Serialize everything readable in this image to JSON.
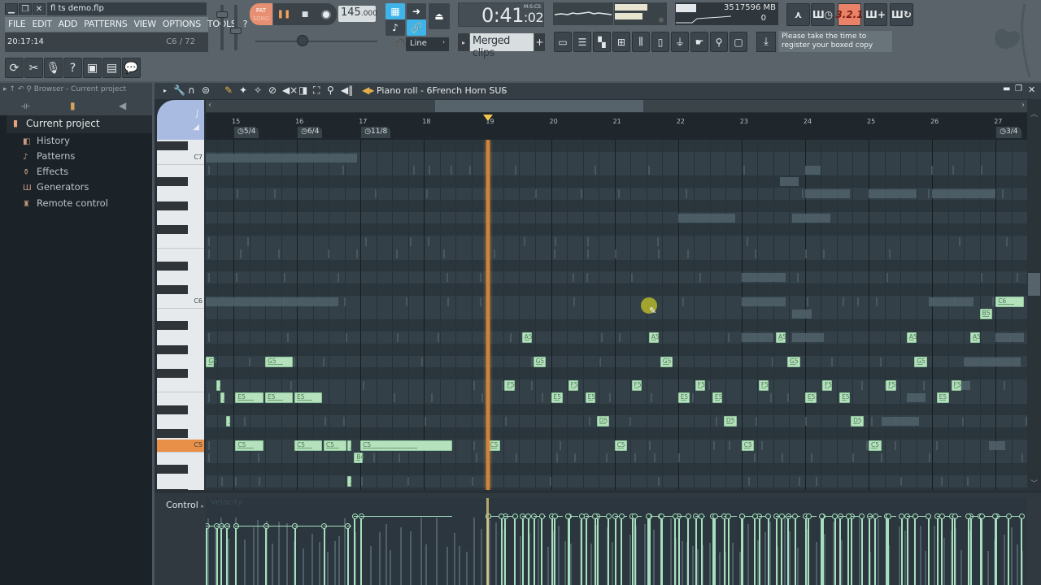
{
  "window": {
    "title": "fl ts demo.flp",
    "controls": [
      "minimize",
      "restore",
      "close"
    ]
  },
  "menu": [
    "FILE",
    "EDIT",
    "ADD",
    "PATTERNS",
    "VIEW",
    "OPTIONS",
    "TOOLS",
    "?"
  ],
  "hint_bar": {
    "time": "20:17:14",
    "note": "C6 / 72"
  },
  "toolbar_left": [
    "refresh-icon",
    "cut-audio-icon",
    "microphone-icon",
    "help-icon",
    "save-icon",
    "export-audio-icon",
    "chat-icon"
  ],
  "transport": {
    "pat_label": "PAT",
    "song_label": "SONG",
    "tempo_int": "145",
    "tempo_frac": ".000",
    "time": "0:41",
    "time_sub": ":02",
    "time_format": "M:S:CS"
  },
  "snap": {
    "value": "Line"
  },
  "pattern": {
    "name": "Merged clips",
    "add_label": "+"
  },
  "cpu": {
    "cpu_value": "35",
    "memory": "17596 MB",
    "polyphony": "0"
  },
  "register_notice": "Please take the time to register your boxed copy",
  "right_buttons": [
    "metronome",
    "wait-record",
    "3.2.1",
    "step-edit",
    "loop-record"
  ],
  "right_button_countdown": "3.2.1",
  "browser": {
    "header": "Browser - Current project",
    "root": "Current project",
    "items": [
      {
        "label": "History",
        "icon": "history-icon"
      },
      {
        "label": "Patterns",
        "icon": "note-icon"
      },
      {
        "label": "Effects",
        "icon": "effects-icon"
      },
      {
        "label": "Generators",
        "icon": "generators-icon"
      },
      {
        "label": "Remote control",
        "icon": "remote-icon"
      }
    ]
  },
  "piano_roll": {
    "title": "Piano roll - 6French Horn SUS",
    "bars": [
      "15",
      "16",
      "17",
      "18",
      "19",
      "20",
      "21",
      "22",
      "23",
      "24",
      "25",
      "26",
      "27"
    ],
    "time_signatures": [
      {
        "bar": 15,
        "label": "5/4"
      },
      {
        "bar": 16,
        "label": "6/4"
      },
      {
        "bar": 17,
        "label": "11/8"
      },
      {
        "bar": 27,
        "label": "3/4"
      }
    ],
    "key_labels": [
      "C7",
      "C6",
      "C5"
    ],
    "highlighted_key": "C5",
    "playhead_bar": 19,
    "control_label": "Control",
    "control_target": "Velocity",
    "notes": [
      {
        "n": "G5",
        "b": 14.57,
        "len": 0.12
      },
      {
        "n": "G5",
        "b": 15.5,
        "len": 0.44
      },
      {
        "n": "",
        "b": 14.73,
        "len": 0.05,
        "p": "F5"
      },
      {
        "n": "",
        "b": 14.8,
        "len": 0.05,
        "p": "E5"
      },
      {
        "n": "E5",
        "b": 15.03,
        "len": 0.44
      },
      {
        "n": "E5",
        "b": 15.5,
        "len": 0.44
      },
      {
        "n": "E5",
        "b": 15.96,
        "len": 0.44
      },
      {
        "n": "",
        "b": 14.89,
        "len": 0.05,
        "p": "D5"
      },
      {
        "n": "C5",
        "b": 15.03,
        "len": 0.44
      },
      {
        "n": "C5",
        "b": 15.96,
        "len": 0.44
      },
      {
        "n": "C5",
        "b": 16.42,
        "len": 0.36
      },
      {
        "n": "",
        "b": 16.79,
        "len": 0.07,
        "p": "C5"
      },
      {
        "n": "B4",
        "b": 16.9,
        "len": 0.13
      },
      {
        "n": "",
        "b": 16.79,
        "len": 0.06,
        "p": "A4"
      },
      {
        "n": "C5",
        "b": 17.0,
        "len": 1.45
      },
      {
        "n": "C5",
        "b": 19.0,
        "len": 0.2
      },
      {
        "n": "F5",
        "b": 19.27,
        "len": 0.16
      },
      {
        "n": "A5",
        "b": 19.54,
        "len": 0.16
      },
      {
        "n": "G5",
        "b": 19.72,
        "len": 0.2
      },
      {
        "n": "E5",
        "b": 20.0,
        "len": 0.18
      },
      {
        "n": "F5",
        "b": 20.27,
        "len": 0.16
      },
      {
        "n": "E5",
        "b": 20.54,
        "len": 0.16
      },
      {
        "n": "D5",
        "b": 20.72,
        "len": 0.2
      },
      {
        "n": "C5",
        "b": 21.0,
        "len": 0.2
      },
      {
        "n": "F5",
        "b": 21.27,
        "len": 0.16
      },
      {
        "n": "A5",
        "b": 21.54,
        "len": 0.16
      },
      {
        "n": "G5",
        "b": 21.72,
        "len": 0.2
      },
      {
        "n": "E5",
        "b": 22.0,
        "len": 0.18
      },
      {
        "n": "F5",
        "b": 22.27,
        "len": 0.16
      },
      {
        "n": "E5",
        "b": 22.54,
        "len": 0.16
      },
      {
        "n": "D5",
        "b": 22.72,
        "len": 0.2
      },
      {
        "n": "C5",
        "b": 23.0,
        "len": 0.2
      },
      {
        "n": "F5",
        "b": 23.27,
        "len": 0.16
      },
      {
        "n": "A5",
        "b": 23.54,
        "len": 0.16
      },
      {
        "n": "G5",
        "b": 23.72,
        "len": 0.2
      },
      {
        "n": "E5",
        "b": 24.0,
        "len": 0.18
      },
      {
        "n": "F5",
        "b": 24.27,
        "len": 0.16
      },
      {
        "n": "E5",
        "b": 24.54,
        "len": 0.16
      },
      {
        "n": "D5",
        "b": 24.72,
        "len": 0.2
      },
      {
        "n": "C5",
        "b": 25.0,
        "len": 0.2
      },
      {
        "n": "F5",
        "b": 25.27,
        "len": 0.16
      },
      {
        "n": "A5",
        "b": 25.6,
        "len": 0.16
      },
      {
        "n": "G5",
        "b": 25.72,
        "len": 0.2
      },
      {
        "n": "E5",
        "b": 26.07,
        "len": 0.2
      },
      {
        "n": "F5",
        "b": 26.3,
        "len": 0.16
      },
      {
        "n": "A5",
        "b": 26.6,
        "len": 0.16
      },
      {
        "n": "B5",
        "b": 26.75,
        "len": 0.2
      },
      {
        "n": "C6",
        "b": 27.0,
        "len": 0.45
      }
    ]
  }
}
